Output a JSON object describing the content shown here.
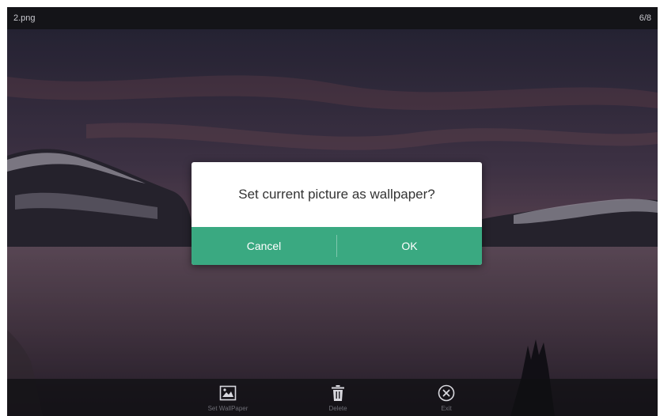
{
  "header": {
    "filename": "2.png",
    "counter": "6/8"
  },
  "dialog": {
    "message": "Set current picture as wallpaper?",
    "cancel_label": "Cancel",
    "ok_label": "OK"
  },
  "toolbar": {
    "items": [
      {
        "label": "Set WallPaper",
        "icon": "image-icon"
      },
      {
        "label": "Delete",
        "icon": "trash-icon"
      },
      {
        "label": "Exit",
        "icon": "close-circle-icon"
      }
    ]
  },
  "colors": {
    "accent": "#3aa981",
    "topbar": "#141418"
  }
}
